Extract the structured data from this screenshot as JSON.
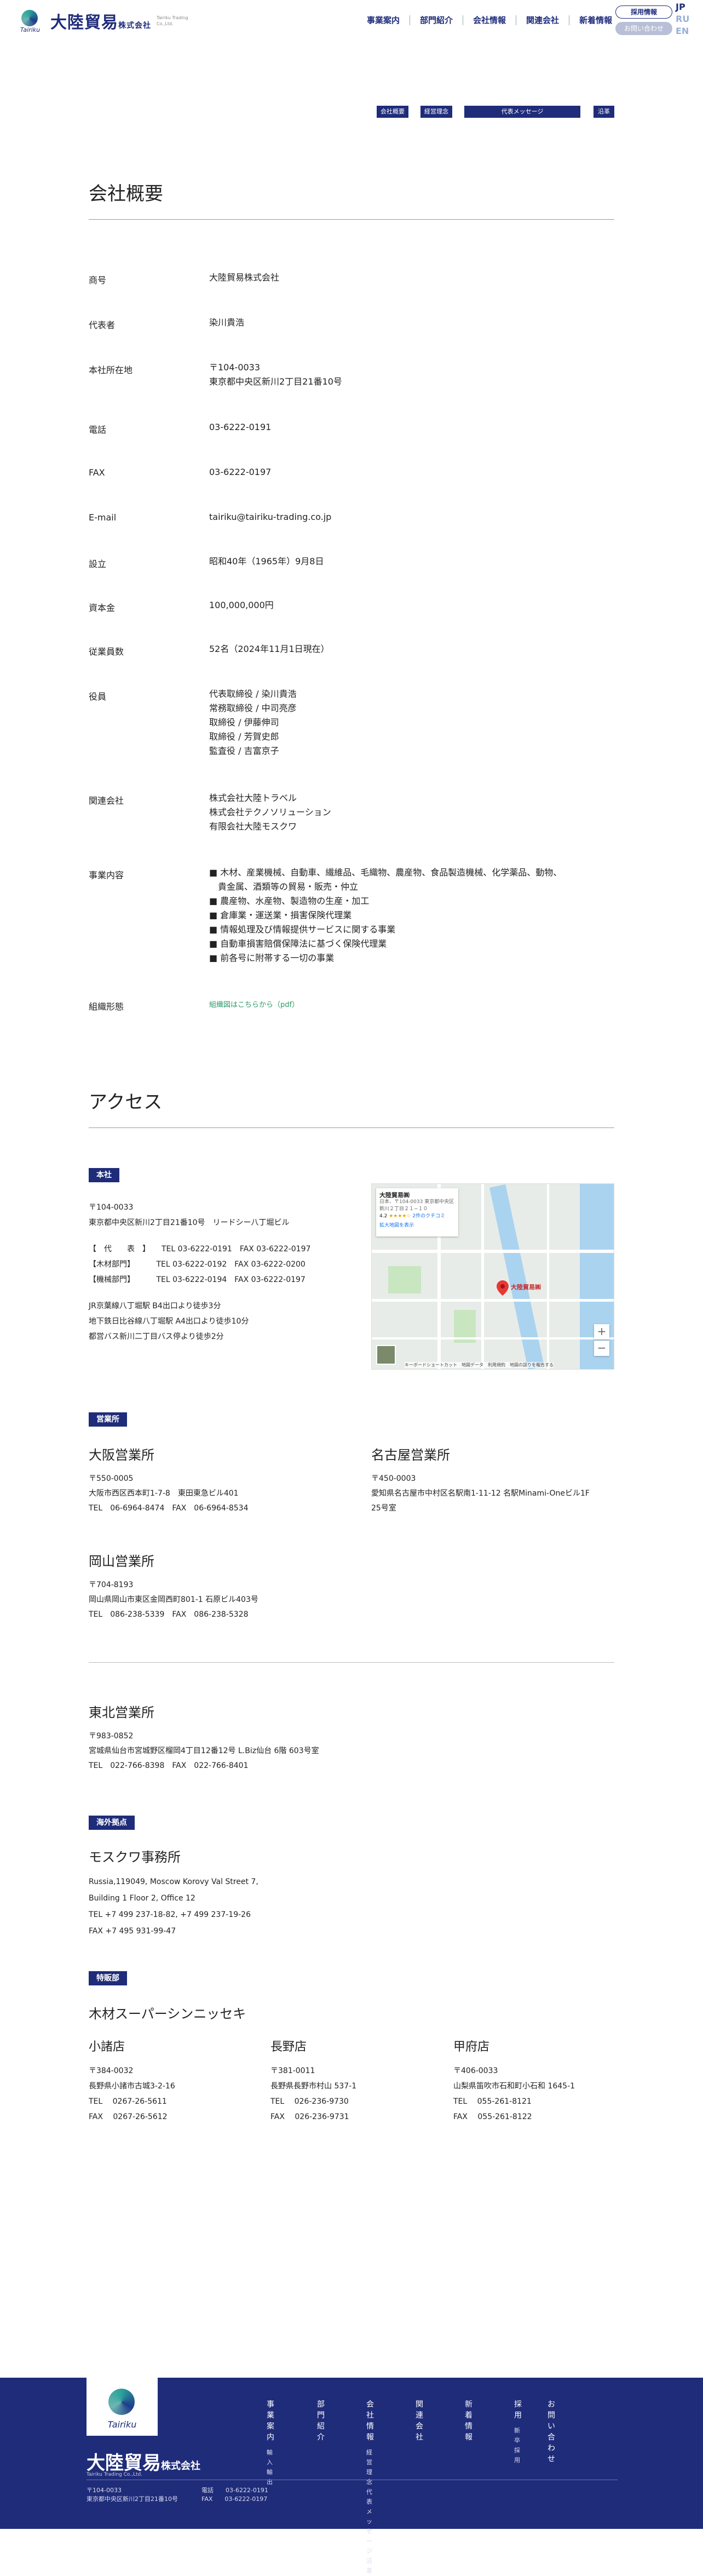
{
  "header": {
    "logo_romaji": "Tairiku",
    "logo_name": "大陸貿易",
    "logo_suffix": "株式会社",
    "logo_en": "Tairiku Trading Co.,Ltd.",
    "nav": [
      "事業案内",
      "部門紹介",
      "会社情報",
      "関連会社",
      "新着情報"
    ],
    "recruit": "採用情報",
    "ir": "お問い合わせ",
    "lang": [
      "JP",
      "RU",
      "EN"
    ]
  },
  "tabs": [
    "会社概要",
    "経営理念",
    "代表メッセージ",
    "沿革"
  ],
  "overview": {
    "title": "会社概要",
    "rows": [
      {
        "label": "商号",
        "value": [
          "大陸貿易株式会社"
        ]
      },
      {
        "label": "代表者",
        "value": [
          "染川貴浩"
        ]
      },
      {
        "label": "本社所在地",
        "value": [
          "〒104-0033",
          "東京都中央区新川2丁目21番10号"
        ]
      },
      {
        "label": "電話",
        "value": [
          "03-6222-0191"
        ]
      },
      {
        "label": "FAX",
        "value": [
          "03-6222-0197"
        ]
      },
      {
        "label": "E-mail",
        "value": [
          "tairiku@tairiku-trading.co.jp"
        ]
      },
      {
        "label": "設立",
        "value": [
          "昭和40年（1965年）9月8日"
        ]
      },
      {
        "label": "資本金",
        "value": [
          "100,000,000円"
        ]
      },
      {
        "label": "従業員数",
        "value": [
          "52名（2024年11月1日現在）"
        ]
      },
      {
        "label": "役員",
        "value": [
          "代表取締役 / 染川貴浩",
          "常務取締役 / 中司亮彦",
          "取締役 / 伊藤伸司",
          "取締役 / 芳賀史郎",
          "監査役 / 吉富京子"
        ]
      },
      {
        "label": "関連会社",
        "value": [
          "株式会社大陸トラベル",
          "株式会社テクノソリューション",
          "有限会社大陸モスクワ"
        ]
      },
      {
        "label": "事業内容",
        "value": [
          "■ 木材、産業機械、自動車、繊維品、毛織物、農産物、食品製造機械、化学薬品、動物、",
          "　貴金属、酒類等の貿易・販売・仲立",
          "■ 農産物、水産物、製造物の生産・加工",
          "■ 倉庫業・運送業・損害保険代理業",
          "■ 情報処理及び情報提供サービスに関する事業",
          "■ 自動車損害賠償保障法に基づく保険代理業",
          "■ 前各号に附帯する一切の事業"
        ]
      },
      {
        "label": "組織形態",
        "value": [
          "組織図はこちらから（pdf）"
        ]
      }
    ]
  },
  "access": {
    "title": "アクセス",
    "hq_badge": "本社",
    "hq_lines": [
      "〒104-0033",
      "東京都中央区新川2丁目21番10号　リードシー八丁堀ビル",
      "",
      "【　代　　表　】　　TEL 03-6222-0191　FAX 03-6222-0197",
      "【木材部門】　　　 TEL 03-6222-0192　FAX 03-6222-0200",
      "【機械部門】　　　 TEL 03-6222-0194　FAX 03-6222-0197",
      "",
      "JR京葉線八丁堀駅 B4出口より徒歩3分",
      "地下鉄日比谷線八丁堀駅 A4出口より徒歩10分",
      "都営バス新川二丁目バス停より徒歩2分"
    ],
    "map": {
      "place": "大陸貿易㈱",
      "address": "日本、〒104-0033 東京都中央区新川２丁目２１−１０",
      "rating": "4.2",
      "stars": "★★★★☆",
      "reviews": "2件のクチコミ",
      "enlarge": "拡大地図を表示",
      "pin_label": "大陸貿易㈱",
      "zoom_in": "+",
      "zoom_out": "−",
      "credits": "キーボードショートカット　地図データ　利用規約　地図の誤りを報告する"
    },
    "sales_badge": "営業所",
    "offices": [
      {
        "name": "大阪営業所",
        "lines": [
          "〒550-0005",
          "大阪市西区西本町1-7-8　東田東急ビル401",
          "TEL　06-6964-8474　FAX　06-6964-8534"
        ]
      },
      {
        "name": "名古屋営業所",
        "lines": [
          "〒450-0003",
          "愛知県名古屋市中村区名駅南1-11-12 名駅Minami-Oneビル1F",
          "25号室"
        ]
      },
      {
        "name": "岡山営業所",
        "lines": [
          "〒704-8193",
          "岡山県岡山市東区金岡西町801-1 石原ビル403号",
          "TEL　086-238-5339　FAX　086-238-5328"
        ]
      },
      {
        "name": "東北営業所",
        "lines": [
          "〒983-0852",
          "宮城県仙台市宮城野区榴岡4丁目12番12号 L.Biz仙台 6階 603号室",
          "TEL　022-766-8398　FAX　022-766-8401"
        ]
      }
    ],
    "overseas_badge": "海外拠点",
    "moscow": {
      "name": "モスクワ事務所",
      "lines": [
        "Russia,119049, Moscow Korovy Val Street 7,",
        "Building 1 Floor 2, Office 12",
        "TEL +7 499 237-18-82, +7 499 237-19-26",
        "FAX +7 495 931-99-47"
      ]
    },
    "agency_badge": "特販部",
    "agency_name": "木材スーパーシンニッセキ",
    "stores": [
      {
        "name": "小諸店",
        "lines": [
          "〒384-0032",
          "長野県小諸市古城3-2-16",
          "TEL　 0267-26-5611",
          "FAX　 0267-26-5612"
        ]
      },
      {
        "name": "長野店",
        "lines": [
          "〒381-0011",
          "長野県長野市村山 537-1",
          "TEL　 026-236-9730",
          "FAX　 026-236-9731"
        ]
      },
      {
        "name": "甲府店",
        "lines": [
          "〒406-0033",
          "山梨県笛吹市石和町小石和 1645-1",
          "TEL　 055-261-8121",
          "FAX　 055-261-8122"
        ]
      }
    ]
  },
  "footer": {
    "logo_romaji": "Tairiku",
    "name": "大陸貿易",
    "suffix": "株式会社",
    "en": "Tairiku Trading Co.,Ltd.",
    "cols": [
      {
        "main": "事業案内",
        "subs": [
          "輸入",
          "輸出"
        ]
      },
      {
        "main": "部門紹介",
        "subs": []
      },
      {
        "main": "会社情報",
        "subs": [
          "経営理念",
          "代表メッセージ",
          "沿革"
        ]
      },
      {
        "main": "関連会社",
        "subs": []
      },
      {
        "main": "新着情報",
        "subs": []
      },
      {
        "main": "採用",
        "subs": [
          "新卒採用"
        ]
      },
      {
        "main": "お問い合わせ",
        "subs": []
      }
    ],
    "address": [
      "〒104-0033",
      "東京都中央区新川2丁目21番10号"
    ],
    "tel": "電話　　03-6222-0191",
    "fax": "FAX　　03-6222-0197"
  }
}
